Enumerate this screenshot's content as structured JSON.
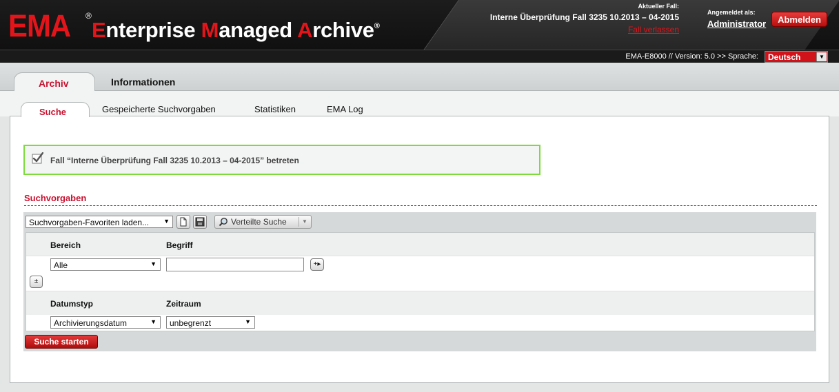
{
  "header": {
    "logo_ema": "EMA",
    "logo_reg": "®",
    "logo_title_parts": [
      "E",
      "nterprise ",
      "M",
      "anaged ",
      "A",
      "rchive"
    ],
    "current_case_label": "Aktueller Fall:",
    "current_case_name": "Interne Überprüfung Fall 3235 10.2013 – 04-2015",
    "leave_case_link": "Fall verlassen",
    "logged_in_label": "Angemeldet als:",
    "user_name": "Administrator",
    "logout_button": "Abmelden"
  },
  "version_bar": {
    "version_text": "EMA-E8000 // Version: 5.0 >> Sprache:",
    "language_selected": "Deutsch"
  },
  "main_tabs": [
    {
      "label": "Archiv",
      "active": true
    },
    {
      "label": "Informationen",
      "active": false
    }
  ],
  "sub_tabs": [
    {
      "label": "Suche",
      "active": true
    },
    {
      "label": "Gespeicherte Suchvorgaben",
      "active": false
    },
    {
      "label": "Statistiken",
      "active": false
    },
    {
      "label": "EMA Log",
      "active": false
    }
  ],
  "notice": {
    "message": "Fall “Interne Überprüfung Fall 3235 10.2013 – 04-2015” betreten"
  },
  "search_presets": {
    "title": "Suchvorgaben",
    "favorites_select": "Suchvorgaben-Favoriten laden...",
    "distributed_search_button": "Verteilte Suche",
    "columns": {
      "area": "Bereich",
      "term": "Begriff",
      "date_type": "Datumstyp",
      "period": "Zeitraum"
    },
    "area_value": "Alle",
    "term_value": "",
    "date_type_value": "Archivierungsdatum",
    "period_value": "unbegrenzt",
    "start_button": "Suche starten"
  },
  "colors": {
    "brand_red": "#e3151b",
    "tab_red": "#c8102e",
    "notice_border": "#7ddb3c"
  }
}
